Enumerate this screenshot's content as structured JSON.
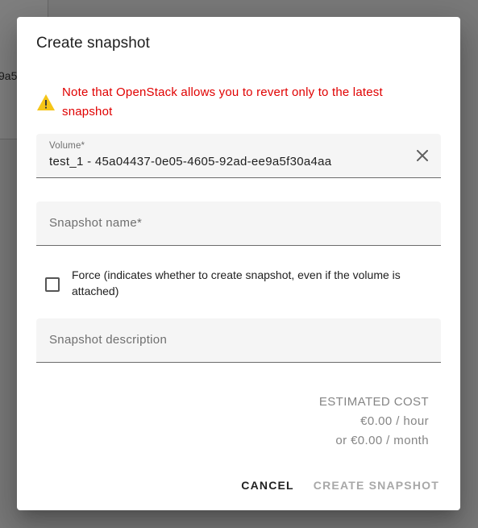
{
  "background": {
    "partial_text": "9a5"
  },
  "dialog": {
    "title": "Create snapshot",
    "warning": {
      "icon": "warning-icon",
      "color": "#e00000",
      "text": "Note that OpenStack allows you to revert only to the latest snapshot"
    },
    "volume": {
      "label": "Volume*",
      "value": "test_1 - 45a04437-0e05-4605-92ad-ee9a5f30a4aa",
      "clear_icon": "close-icon"
    },
    "snapshot_name": {
      "placeholder": "Snapshot name*",
      "value": ""
    },
    "force": {
      "label": "Force (indicates whether to create snapshot, even if the volume is attached)",
      "checked": false
    },
    "snapshot_description": {
      "placeholder": "Snapshot description",
      "value": ""
    },
    "cost": {
      "heading": "ESTIMATED COST",
      "hourly": "€0.00 / hour",
      "monthly": "or €0.00 / month"
    },
    "actions": {
      "cancel_label": "CANCEL",
      "create_label": "CREATE SNAPSHOT"
    }
  }
}
